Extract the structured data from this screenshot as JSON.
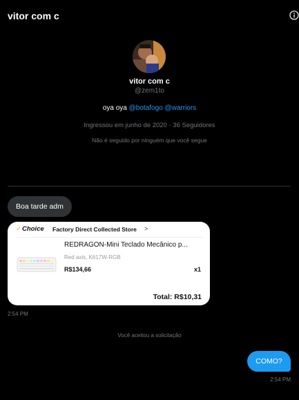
{
  "header": {
    "title": "vitor com c",
    "info_icon": "info-icon"
  },
  "profile": {
    "name": "vitor com c",
    "handle": "@zem1to",
    "bio_prefix": "oya oya",
    "bio_mention_1": "@botafogo",
    "bio_mention_2": "@warriors",
    "joined": "Ingressou em junho de 2020 · 36 Seguidores",
    "not_followed": "Não é seguido por ninguém que você segue"
  },
  "messages": {
    "incoming_text": "Boa tarde adm",
    "card": {
      "badge": "Choice",
      "store": "Factory Direct Collected Store",
      "chevron": ">",
      "product_name": "REDRAGON-Mini Teclado Mecânico p...",
      "variant": "Red axis, K617W-RGB",
      "price": "R$134,66",
      "quantity": "x1",
      "total": "Total: R$10,31"
    },
    "incoming_time": "2:54 PM",
    "system_notice": "Você aceitou a solicitação",
    "outgoing_text": "COMO?",
    "outgoing_time": "2:54 PM"
  },
  "colors": {
    "accent": "#1d9bf0",
    "muted": "#71767b",
    "bubble_in": "#2f3336",
    "background": "#000000"
  }
}
